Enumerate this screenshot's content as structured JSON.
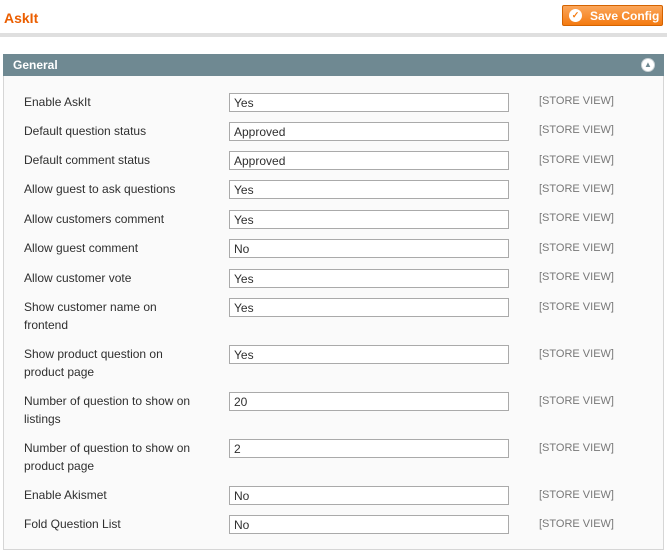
{
  "header": {
    "title": "AskIt",
    "save_label": "Save Config"
  },
  "section": {
    "title": "General"
  },
  "rows": [
    {
      "label": "Enable AskIt",
      "value": "Yes",
      "scope": "[STORE VIEW]"
    },
    {
      "label": "Default question status",
      "value": "Approved",
      "scope": "[STORE VIEW]"
    },
    {
      "label": "Default comment status",
      "value": "Approved",
      "scope": "[STORE VIEW]"
    },
    {
      "label": "Allow guest to ask questions",
      "value": "Yes",
      "scope": "[STORE VIEW]"
    },
    {
      "label": "Allow customers comment",
      "value": "Yes",
      "scope": "[STORE VIEW]"
    },
    {
      "label": "Allow guest comment",
      "value": "No",
      "scope": "[STORE VIEW]"
    },
    {
      "label": "Allow customer vote",
      "value": "Yes",
      "scope": "[STORE VIEW]"
    },
    {
      "label": "Show customer name on frontend",
      "value": "Yes",
      "scope": "[STORE VIEW]"
    },
    {
      "label": "Show product question on product page",
      "value": "Yes",
      "scope": "[STORE VIEW]"
    },
    {
      "label": "Number of question to show on listings",
      "value": "20",
      "scope": "[STORE VIEW]"
    },
    {
      "label": "Number of question to show on product page",
      "value": "2",
      "scope": "[STORE VIEW]"
    },
    {
      "label": "Enable Akismet",
      "value": "No",
      "scope": "[STORE VIEW]"
    },
    {
      "label": "Fold Question List",
      "value": "No",
      "scope": "[STORE VIEW]"
    }
  ],
  "icons": {
    "save": "check-circle-icon",
    "collapse": "collapse-up-icon"
  },
  "colors": {
    "title": "#eb5e00",
    "save_button": "#f47a10",
    "section_header": "#6f8992"
  }
}
